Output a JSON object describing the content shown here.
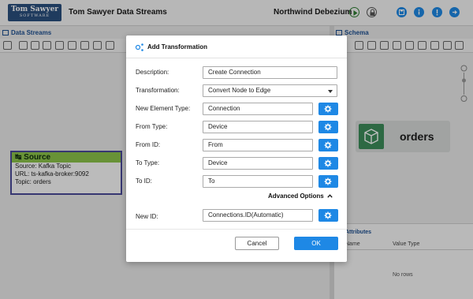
{
  "header": {
    "logo_line1": "Tom Sawyer",
    "logo_line2": "SOFTWARE",
    "app_title": "Tom Sawyer Data Streams",
    "project_name": "Northwind Debezium"
  },
  "panels": {
    "data_streams_title": "Data Streams",
    "schema_title": "Schema",
    "attributes_tab": "Attributes",
    "attributes_col_name": "Name",
    "attributes_col_value_type": "Value Type",
    "attributes_empty": "No rows"
  },
  "source_node": {
    "title": "Source",
    "source_line": "Source: Kafka Topic",
    "url_line": "URL: ts-kafka-broker:9092",
    "topic_line": "Topic: orders"
  },
  "schema_node": {
    "label": "orders"
  },
  "dialog": {
    "title": "Add Transformation",
    "fields": {
      "description": {
        "label": "Description:",
        "value": "Create Connection"
      },
      "transformation": {
        "label": "Transformation:",
        "value": "Convert Node to Edge"
      },
      "new_element_type": {
        "label": "New Element Type:",
        "value": "Connection"
      },
      "from_type": {
        "label": "From Type:",
        "value": "Device"
      },
      "from_id": {
        "label": "From ID:",
        "value": "From"
      },
      "to_type": {
        "label": "To Type:",
        "value": "Device"
      },
      "to_id": {
        "label": "To ID:",
        "value": "To"
      },
      "new_id": {
        "label": "New ID:",
        "value": "Connections.ID(Automatic)"
      }
    },
    "advanced_options_label": "Advanced Options",
    "cancel_label": "Cancel",
    "ok_label": "OK"
  },
  "colors": {
    "accent": "#1e88e5",
    "brand": "#2a4f7e",
    "source_header": "#8bc34a",
    "schema_node": "#3d8c5a"
  }
}
